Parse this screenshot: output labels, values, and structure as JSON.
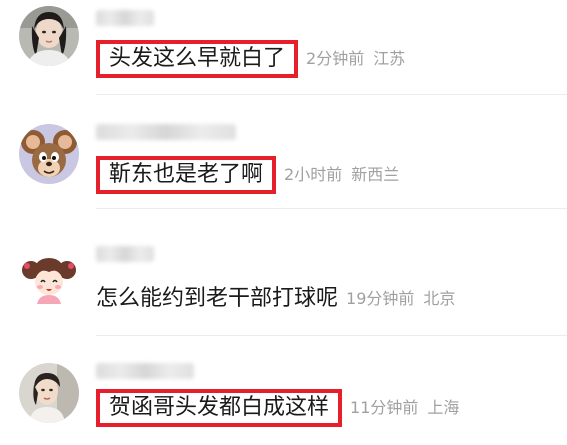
{
  "comments": [
    {
      "text": "头发这么早就白了",
      "time": "2分钟前",
      "location": "江苏",
      "highlighted": true,
      "avatar": "photo-woman-icon"
    },
    {
      "text": "靳东也是老了啊",
      "time": "2小时前",
      "location": "新西兰",
      "highlighted": true,
      "avatar": "cartoon-mouse-icon"
    },
    {
      "text": "怎么能约到老干部打球呢",
      "time": "19分钟前",
      "location": "北京",
      "highlighted": false,
      "avatar": "cartoon-girl-icon"
    },
    {
      "text": "贺函哥头发都白成这样",
      "time": "11分钟前",
      "location": "上海",
      "highlighted": true,
      "avatar": "photo-woman-2-icon"
    }
  ],
  "colors": {
    "highlight_border": "#e5202a",
    "comment_text": "#1a1a1a",
    "meta_text": "#a0a0a0",
    "divider": "#ececec"
  }
}
